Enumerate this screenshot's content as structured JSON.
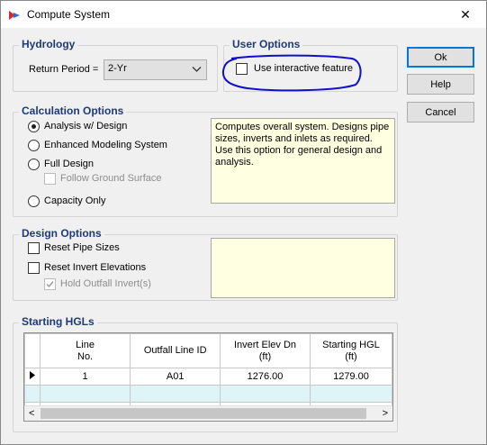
{
  "window": {
    "title": "Compute System",
    "close_glyph": "✕"
  },
  "hydrology": {
    "title": "Hydrology",
    "return_period_label": "Return Period =",
    "return_period_value": "2-Yr"
  },
  "user_options": {
    "title": "User Options",
    "interactive_label": "Use interactive feature",
    "interactive_checked": false
  },
  "calculation_options": {
    "title": "Calculation Options",
    "analysis_design": "Analysis w/ Design",
    "enhanced_modeling": "Enhanced Modeling System",
    "full_design": "Full Design",
    "follow_ground": "Follow Ground Surface",
    "capacity_only": "Capacity Only",
    "selected": "analysis_design",
    "description": "Computes overall system. Designs pipe sizes, inverts and inlets as required. Use this option for general design and analysis."
  },
  "design_options": {
    "title": "Design Options",
    "reset_pipe_sizes": "Reset Pipe Sizes",
    "reset_invert": "Reset Invert Elevations",
    "hold_outfall": "Hold Outfall Invert(s)"
  },
  "starting_hgls": {
    "title": "Starting HGLs",
    "columns": [
      {
        "line1": "Line",
        "line2": "No."
      },
      {
        "line1": "Outfall Line ID",
        "line2": ""
      },
      {
        "line1": "Invert Elev Dn",
        "line2": "(ft)"
      },
      {
        "line1": "Starting HGL",
        "line2": "(ft)"
      }
    ],
    "rows": [
      {
        "line_no": "1",
        "outfall_id": "A01",
        "invert": "1276.00",
        "hgl": "1279.00"
      }
    ],
    "scroll_left": "<",
    "scroll_right": ">"
  },
  "buttons": {
    "ok": "Ok",
    "help": "Help",
    "cancel": "Cancel"
  },
  "colors": {
    "group_title": "#1e3a78",
    "annotation": "#1010c8",
    "accent": "#0078d7"
  }
}
